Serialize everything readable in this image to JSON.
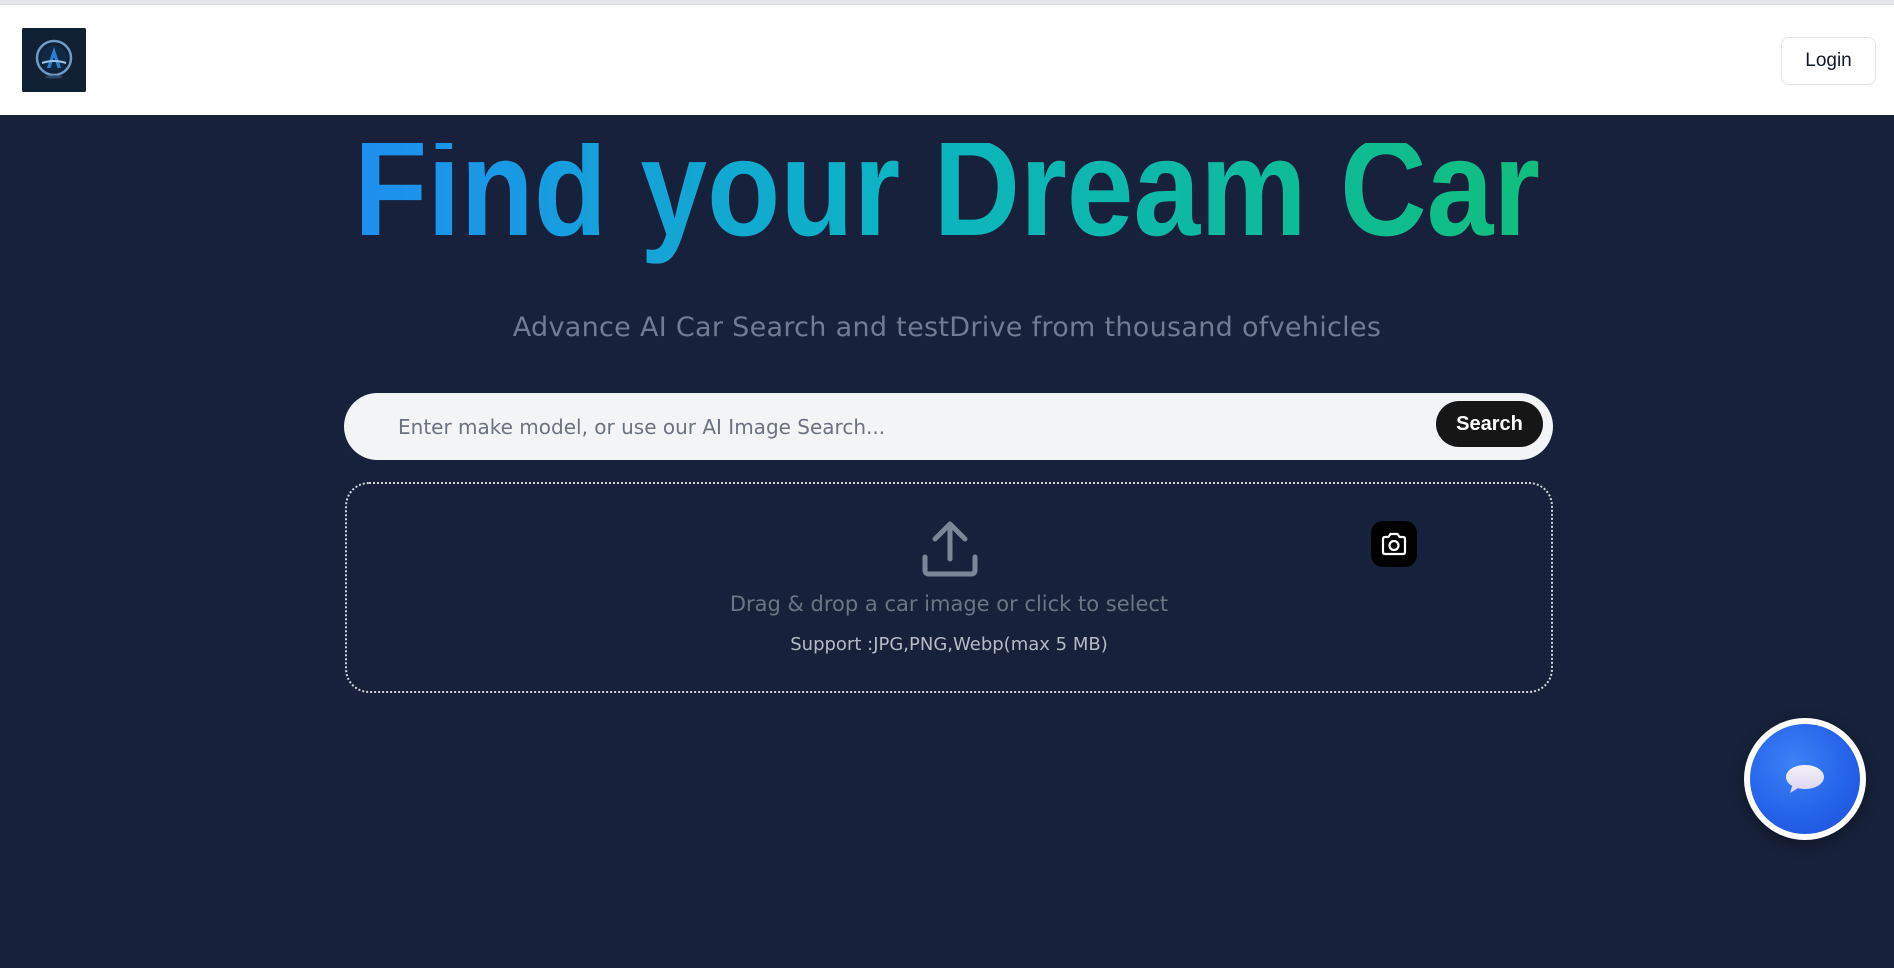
{
  "header": {
    "logo_icon": "car-brand-logo-icon",
    "login_label": "Login"
  },
  "hero": {
    "title": "Find your Dream Car",
    "title_gradient": [
      "#1e8ff0",
      "#10bf7e"
    ],
    "subtitle": "Advance AI Car Search and testDrive from thousand ofvehicles"
  },
  "search": {
    "placeholder": "Enter make model, or use our AI Image Search...",
    "value": "",
    "button_label": "Search"
  },
  "dropzone": {
    "upload_icon": "upload-icon",
    "camera_icon": "camera-icon",
    "text": "Drag & drop a car image or click to select",
    "support_text": "Support :JPG,PNG,Webp(max 5 MB)"
  },
  "chat": {
    "icon": "chat-bubble-icon"
  },
  "colors": {
    "background": "#17213b",
    "header": "#ffffff",
    "search_button": "#161616",
    "chat_button": "#2563eb"
  }
}
